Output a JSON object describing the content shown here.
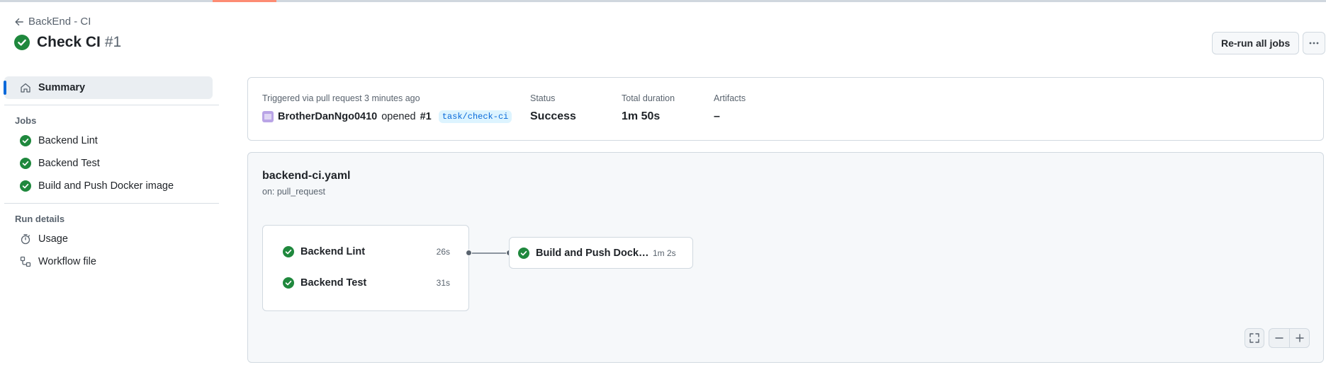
{
  "header": {
    "back_label": "BackEnd - CI",
    "title": "Check CI",
    "run_number": "#1",
    "rerun_label": "Re-run all jobs"
  },
  "sidebar": {
    "summary_label": "Summary",
    "jobs_heading": "Jobs",
    "jobs": [
      {
        "label": "Backend Lint",
        "status": "success"
      },
      {
        "label": "Backend Test",
        "status": "success"
      },
      {
        "label": "Build and Push Docker image",
        "status": "success"
      }
    ],
    "run_details_heading": "Run details",
    "usage_label": "Usage",
    "workflow_file_label": "Workflow file"
  },
  "summary": {
    "trigger_text": "Triggered via pull request 3 minutes ago",
    "actor": "BrotherDanNgo0410",
    "opened_text": "opened",
    "pr_number": "#1",
    "branch": "task/check-ci",
    "status_label": "Status",
    "status_value": "Success",
    "duration_label": "Total duration",
    "duration_value": "1m 50s",
    "artifacts_label": "Artifacts",
    "artifacts_value": "–"
  },
  "graph": {
    "workflow_file": "backend-ci.yaml",
    "trigger": "on: pull_request",
    "stage1": [
      {
        "name": "Backend Lint",
        "duration": "26s"
      },
      {
        "name": "Backend Test",
        "duration": "31s"
      }
    ],
    "stage2": [
      {
        "name": "Build and Push Docker i...",
        "duration": "1m 2s"
      }
    ]
  },
  "colors": {
    "success": "#1f883d",
    "accent": "#0969da",
    "tab_underline": "#fd8c73"
  }
}
